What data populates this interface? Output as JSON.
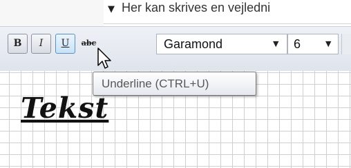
{
  "instruction_field": {
    "text": "Her kan skrives en vejledni",
    "arrow": "▼"
  },
  "toolbar": {
    "bold_label": "B",
    "italic_label": "I",
    "underline_label": "U",
    "strikethrough_label": "abc",
    "font_name": "Garamond",
    "font_size": "6",
    "dropdown_arrow": "▼"
  },
  "tooltip": {
    "text": "Underline (CTRL+U)"
  },
  "canvas": {
    "sample_text": "Tekst"
  },
  "colors": {
    "toolbar_bg": "#e4e8ef",
    "grid_line": "#cfcfcf",
    "tooltip_text": "#575757"
  }
}
